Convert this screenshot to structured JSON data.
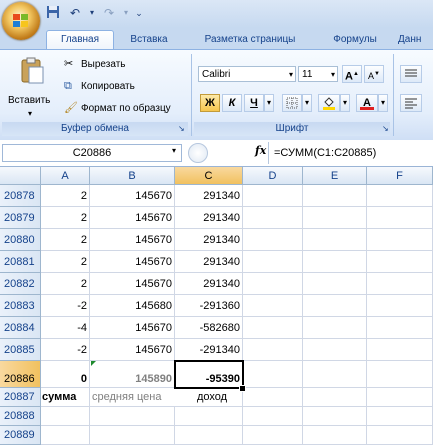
{
  "quick_access": {
    "save_icon": "save-icon",
    "undo_icon": "undo-icon",
    "redo_icon": "redo-icon"
  },
  "tabs": [
    "Главная",
    "Вставка",
    "Разметка страницы",
    "Формулы",
    "Данн"
  ],
  "ribbon": {
    "clipboard": {
      "paste_label": "Вставить",
      "cut_label": "Вырезать",
      "copy_label": "Копировать",
      "format_painter_label": "Формат по образцу",
      "group_label": "Буфер обмена"
    },
    "font": {
      "font_name": "Calibri",
      "font_size": "11",
      "group_label": "Шрифт",
      "bold": "Ж",
      "italic": "К",
      "underline": "Ч",
      "grow": "A",
      "shrink": "A"
    }
  },
  "formula_bar": {
    "name_box": "C20886",
    "fx": "fx",
    "formula": "=СУММ(C1:C20885)"
  },
  "columns": [
    "A",
    "B",
    "C",
    "D",
    "E",
    "F"
  ],
  "rows": [
    {
      "num": "20878",
      "a": "2",
      "b": "145670",
      "c": "291340"
    },
    {
      "num": "20879",
      "a": "2",
      "b": "145670",
      "c": "291340"
    },
    {
      "num": "20880",
      "a": "2",
      "b": "145670",
      "c": "291340"
    },
    {
      "num": "20881",
      "a": "2",
      "b": "145670",
      "c": "291340"
    },
    {
      "num": "20882",
      "a": "2",
      "b": "145670",
      "c": "291340"
    },
    {
      "num": "20883",
      "a": "-2",
      "b": "145680",
      "c": "-291360"
    },
    {
      "num": "20884",
      "a": "-4",
      "b": "145670",
      "c": "-582680"
    },
    {
      "num": "20885",
      "a": "-2",
      "b": "145670",
      "c": "-291340"
    },
    {
      "num": "20886",
      "a": "0",
      "b": "145890",
      "c": "-95390"
    },
    {
      "num": "20887",
      "a": "сумма",
      "b": "средняя цена",
      "c": "доход"
    },
    {
      "num": "20888",
      "a": "",
      "b": "",
      "c": ""
    },
    {
      "num": "20889",
      "a": "",
      "b": "",
      "c": ""
    }
  ],
  "colors": {
    "accent": "#15428b",
    "selected_header": "#f1c15f"
  }
}
